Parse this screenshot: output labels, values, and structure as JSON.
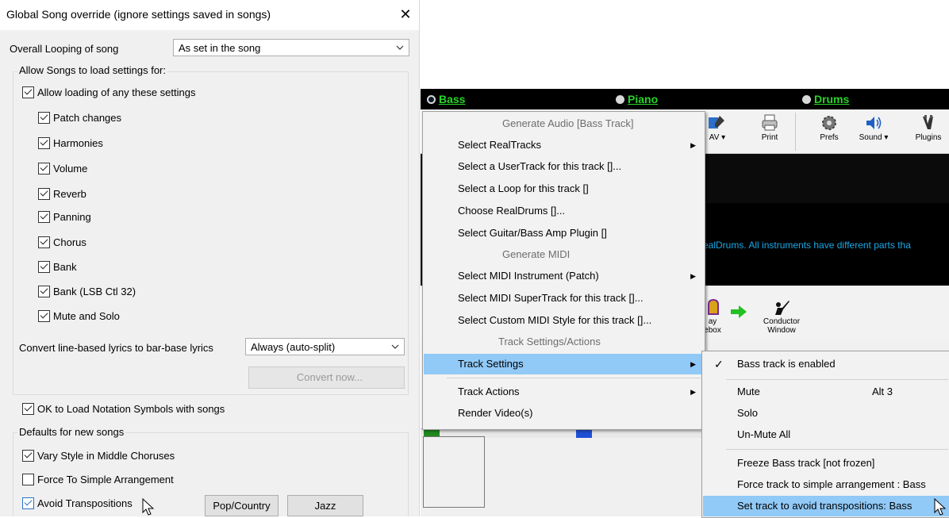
{
  "dialog": {
    "title": "Global Song override (ignore settings saved in songs)",
    "close_glyph": "✕",
    "looping_label": "Overall Looping of song",
    "looping_value": "As set in the song",
    "allow_group_title": "Allow Songs to load settings for:",
    "allow_any_label": "Allow loading of any these settings",
    "settings": [
      {
        "label": "Patch changes",
        "checked": true
      },
      {
        "label": "Harmonies",
        "checked": true
      },
      {
        "label": "Volume",
        "checked": true
      },
      {
        "label": "Reverb",
        "checked": true
      },
      {
        "label": "Panning",
        "checked": true
      },
      {
        "label": "Chorus",
        "checked": true
      },
      {
        "label": "Bank",
        "checked": true
      },
      {
        "label": "Bank (LSB Ctl 32)",
        "checked": true
      },
      {
        "label": "Mute and Solo",
        "checked": true
      }
    ],
    "lyrics_label": "Convert line-based lyrics to bar-base lyrics",
    "lyrics_value": "Always (auto-split)",
    "convert_button": "Convert now...",
    "notation_label": "OK to Load Notation Symbols with songs",
    "defaults_title": "Defaults for new songs",
    "vary_label": "Vary Style in Middle Choruses",
    "force_label": "Force To Simple Arrangement",
    "avoid_label": "Avoid Transpositions",
    "pop_button": "Pop/Country",
    "jazz_button": "Jazz"
  },
  "app": {
    "tracks": [
      {
        "label": "Bass",
        "selected": true
      },
      {
        "label": "Piano",
        "selected": false
      },
      {
        "label": "Drums",
        "selected": false
      }
    ],
    "toolbar": {
      "wav_label": "AV ▾",
      "print_label": "Print",
      "prefs_label": "Prefs",
      "sound_label": "Sound ▾",
      "plugins_label": "Plugins"
    },
    "info_text": "ealDrums. All instruments have different parts tha",
    "toolbar2": {
      "jukebox_label_1": "ay",
      "jukebox_label_2": "ebox",
      "conductor_label_1": "Conductor",
      "conductor_label_2": "Window"
    },
    "context_menu": {
      "items": [
        {
          "label": "Generate Audio          [Bass Track]",
          "type": "header"
        },
        {
          "label": "Select RealTracks",
          "type": "submenu"
        },
        {
          "label": "Select a UserTrack for this track []...",
          "type": "item"
        },
        {
          "label": "Select a Loop for this track  []",
          "type": "item"
        },
        {
          "label": "Choose RealDrums []...",
          "type": "item"
        },
        {
          "label": "Select Guitar/Bass Amp Plugin []",
          "type": "item"
        },
        {
          "label": "Generate MIDI",
          "type": "header"
        },
        {
          "label": "Select MIDI Instrument (Patch)",
          "type": "submenu"
        },
        {
          "label": "Select MIDI SuperTrack for this track  []...",
          "type": "item"
        },
        {
          "label": "Select Custom MIDI Style for this track  []...",
          "type": "item"
        },
        {
          "label": "Track Settings/Actions",
          "type": "header"
        },
        {
          "label": "Track Settings",
          "type": "submenu",
          "highlighted": true
        },
        {
          "label": "Track Actions",
          "type": "submenu"
        },
        {
          "label": "Render Video(s)",
          "type": "item"
        }
      ],
      "submenu_glyph": "▶"
    },
    "submenu": {
      "items": [
        {
          "label": "Bass track is enabled",
          "checked": true
        },
        {
          "label": "Mute",
          "shortcut": "Alt 3"
        },
        {
          "label": "Solo"
        },
        {
          "label": "Un-Mute All"
        },
        {
          "label": "Freeze Bass track   [not frozen]"
        },
        {
          "label": "Force track to simple arrangement : Bass"
        },
        {
          "label": "Set track to avoid transpositions: Bass",
          "highlighted": true
        }
      ],
      "check_glyph": "✓"
    }
  }
}
